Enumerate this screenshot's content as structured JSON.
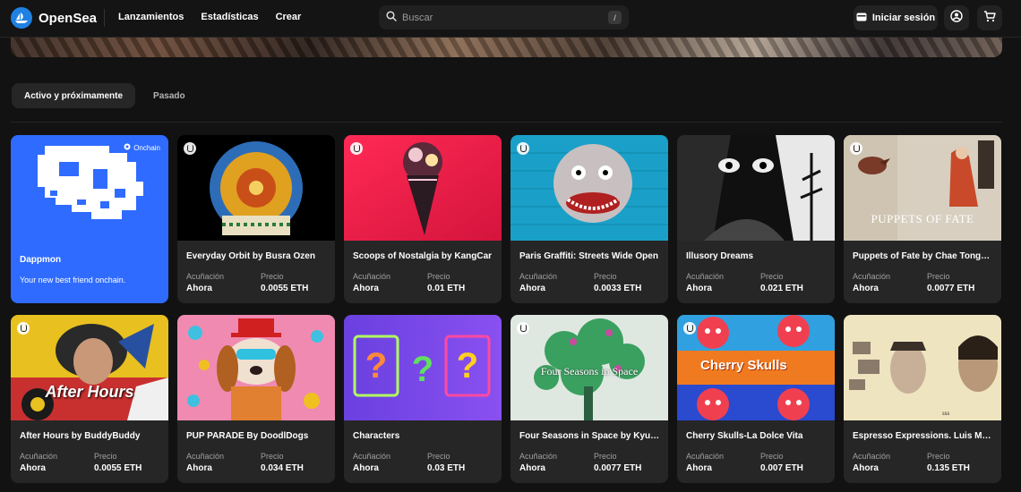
{
  "header": {
    "brand": "OpenSea",
    "nav": [
      "Lanzamientos",
      "Estadísticas",
      "Crear"
    ],
    "search_placeholder": "Buscar",
    "search_shortcut": "/",
    "login_label": "Iniciar sesión",
    "icons": [
      "opensea-logo-icon",
      "search-icon",
      "wallet-icon",
      "profile-icon",
      "cart-icon"
    ]
  },
  "tabs": [
    {
      "label": "Activo y próximamente",
      "active": true
    },
    {
      "label": "Pasado",
      "active": false
    }
  ],
  "featured": {
    "title": "Dappmon",
    "subtitle": "Your new best friend onchain.",
    "tag": "Onchain",
    "color": "#2f6bff"
  },
  "labels": {
    "mint": "Acuñación",
    "price": "Precio"
  },
  "cards": [
    {
      "title": "Everyday Orbit by Busra Ozen",
      "mint": "Ahora",
      "price": "0.0055 ETH"
    },
    {
      "title": "Scoops of Nostalgia by KangCar",
      "mint": "Ahora",
      "price": "0.01 ETH"
    },
    {
      "title": "Paris Graffiti: Streets Wide Open",
      "mint": "Ahora",
      "price": "0.0033 ETH"
    },
    {
      "title": "Illusory Dreams",
      "mint": "Ahora",
      "price": "0.021 ETH"
    },
    {
      "title": "Puppets of Fate by Chae Tongyull",
      "mint": "Ahora",
      "price": "0.0077 ETH",
      "art_text": "PUPPETS OF FATE"
    },
    {
      "title": "After Hours by BuddyBuddy",
      "mint": "Ahora",
      "price": "0.0055 ETH",
      "art_text": "After Hours"
    },
    {
      "title": "PUP PARADE By DoodlDogs",
      "mint": "Ahora",
      "price": "0.034 ETH"
    },
    {
      "title": "Characters",
      "mint": "Ahora",
      "price": "0.03 ETH"
    },
    {
      "title": "Four Seasons in Space by Kyuji...",
      "mint": "Ahora",
      "price": "0.0077 ETH",
      "art_text": "Four Seasons in Space"
    },
    {
      "title": "Cherry Skulls-La Dolce Vita",
      "mint": "Ahora",
      "price": "0.007 ETH",
      "art_text": "Cherry Skulls"
    },
    {
      "title": "Espresso Expressions. Luis Ma...",
      "mint": "Ahora",
      "price": "0.135 ETH"
    }
  ]
}
